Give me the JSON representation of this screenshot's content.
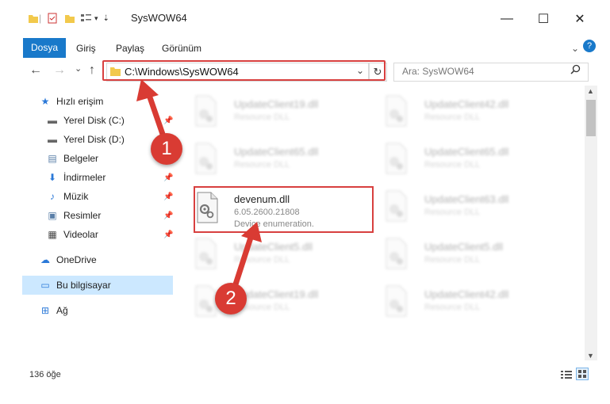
{
  "window": {
    "title": "SysWOW64",
    "minimize": "—",
    "maximize": "☐",
    "close": "✕",
    "help": "?"
  },
  "ribbon": {
    "tabs": [
      "Dosya",
      "Giriş",
      "Paylaş",
      "Görünüm"
    ],
    "expand": "⌄"
  },
  "address": {
    "path": "C:\\Windows\\SysWOW64",
    "dropdown": "⌄",
    "refresh": "↻"
  },
  "search": {
    "placeholder": "Ara: SysWOW64"
  },
  "nav_buttons": {
    "back": "←",
    "forward": "→",
    "recent": "⌄",
    "up": "↑"
  },
  "sidebar": {
    "items": [
      {
        "label": "Hızlı erişim",
        "icon": "★"
      },
      {
        "label": "Yerel Disk (C:)",
        "icon": "▬"
      },
      {
        "label": "Yerel Disk (D:)",
        "icon": "▬"
      },
      {
        "label": "Belgeler",
        "icon": "▤"
      },
      {
        "label": "İndirmeler",
        "icon": "⬇"
      },
      {
        "label": "Müzik",
        "icon": "♪"
      },
      {
        "label": "Resimler",
        "icon": "▣"
      },
      {
        "label": "Videolar",
        "icon": "▦"
      },
      {
        "label": "OneDrive",
        "icon": "☁"
      },
      {
        "label": "Bu bilgisayar",
        "icon": "▭"
      },
      {
        "label": "Ağ",
        "icon": "⊞"
      }
    ]
  },
  "files": [
    {
      "name": "UpdateClient19.dll",
      "desc": "Resource DLL",
      "desc2": ""
    },
    {
      "name": "UpdateClient42.dll",
      "desc": "Resource DLL",
      "desc2": ""
    },
    {
      "name": "UpdateClient65.dll",
      "desc": "Resource DLL",
      "desc2": ""
    },
    {
      "name": "UpdateClient65.dll",
      "desc": "Resource DLL",
      "desc2": ""
    },
    {
      "name": "devenum.dll",
      "desc": "6.05.2600.21808",
      "desc2": "Device enumeration."
    },
    {
      "name": "UpdateClient63.dll",
      "desc": "Resource DLL",
      "desc2": ""
    },
    {
      "name": "UpdateClient5.dll",
      "desc": "Resource DLL",
      "desc2": ""
    },
    {
      "name": "UpdateClient5.dll",
      "desc": "Resource DLL",
      "desc2": ""
    },
    {
      "name": "UpdateClient19.dll",
      "desc": "Resource DLL",
      "desc2": ""
    },
    {
      "name": "UpdateClient42.dll",
      "desc": "Resource DLL",
      "desc2": ""
    }
  ],
  "status": {
    "count": "136 öğe"
  },
  "annotations": [
    "1",
    "2"
  ],
  "colors": {
    "accent": "#1979ca",
    "highlight": "#d8403f",
    "selected": "#cce8ff"
  }
}
